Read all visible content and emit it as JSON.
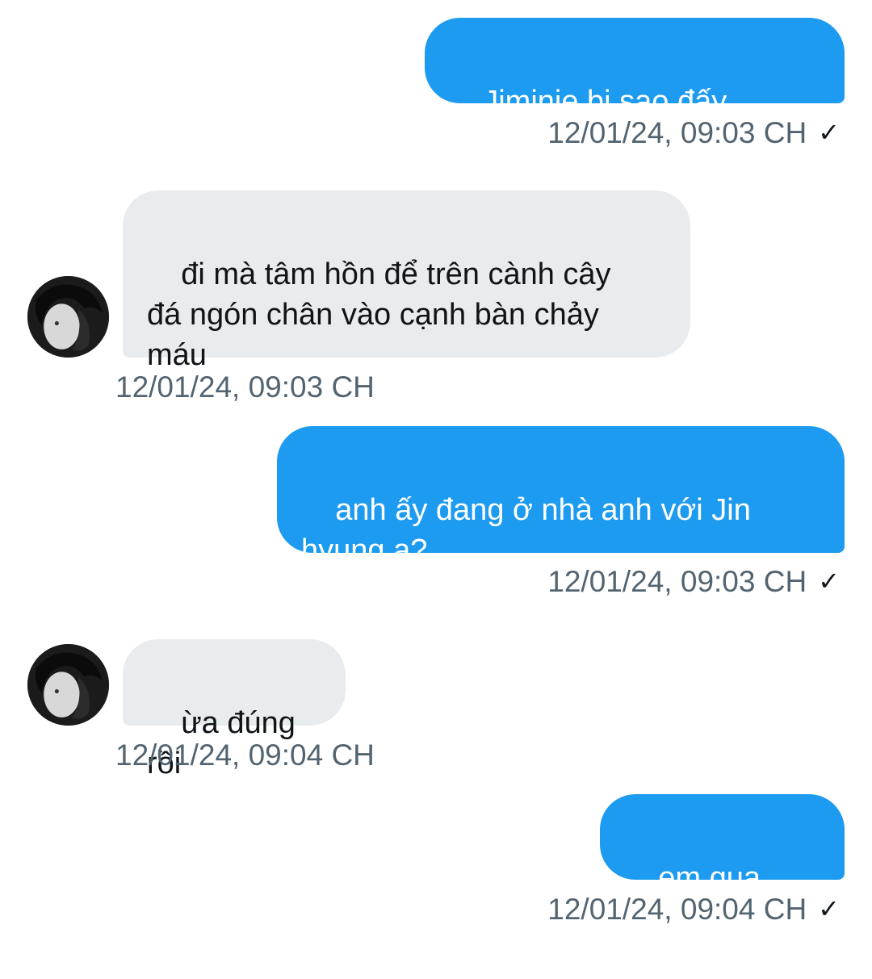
{
  "messages": [
    {
      "direction": "outgoing",
      "text": "Jiminie bị sao đấy ạ????",
      "time": "12/01/24, 09:03 CH",
      "status_icon": "checkmark-icon"
    },
    {
      "direction": "incoming",
      "text": "đi mà tâm hồn để trên cành cây\nđá ngón chân vào cạnh bàn chảy\nmáu",
      "time": "12/01/24, 09:03 CH",
      "avatar_icon": "profile-avatar"
    },
    {
      "direction": "outgoing",
      "text": "anh ấy đang ở nhà anh với Jin\nhyung ạ?",
      "time": "12/01/24, 09:03 CH",
      "status_icon": "checkmark-icon"
    },
    {
      "direction": "incoming",
      "text": "ừa đúng rồi",
      "time": "12/01/24, 09:04 CH",
      "avatar_icon": "profile-avatar"
    },
    {
      "direction": "outgoing",
      "text": "em qua ngay",
      "time": "12/01/24, 09:04 CH",
      "status_icon": "checkmark-icon"
    }
  ],
  "colors": {
    "outgoing_bubble": "#1d9bf0",
    "incoming_bubble": "#e8ecef",
    "timestamp": "#536471"
  }
}
